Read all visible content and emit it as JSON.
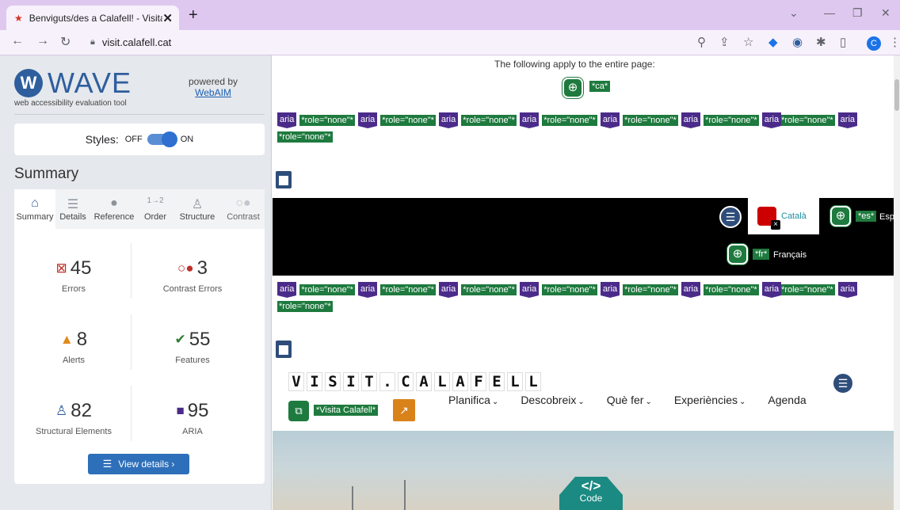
{
  "browser": {
    "tab_title": "Benviguts/des a Calafell! - Visita C",
    "url": "visit.calafell.cat",
    "profile_initial": "C"
  },
  "wave": {
    "logo_word": "WAVE",
    "tagline": "web accessibility evaluation tool",
    "powered_by": "powered by",
    "webaim_link": "WebAIM",
    "styles_label": "Styles:",
    "styles_off": "OFF",
    "styles_on": "ON",
    "summary_title": "Summary",
    "tabs": [
      {
        "label": "Summary",
        "icon": "home-icon"
      },
      {
        "label": "Details",
        "icon": "list-icon"
      },
      {
        "label": "Reference",
        "icon": "info-icon"
      },
      {
        "label": "Order",
        "icon": "order-icon"
      },
      {
        "label": "Structure",
        "icon": "structure-icon"
      },
      {
        "label": "Contrast",
        "icon": "contrast-icon"
      }
    ],
    "stats": {
      "errors": {
        "value": "45",
        "label": "Errors"
      },
      "contrast_errors": {
        "value": "3",
        "label": "Contrast Errors"
      },
      "alerts": {
        "value": "8",
        "label": "Alerts"
      },
      "features": {
        "value": "55",
        "label": "Features"
      },
      "structural": {
        "value": "82",
        "label": "Structural Elements"
      },
      "aria": {
        "value": "95",
        "label": "ARIA"
      }
    },
    "view_details": "View details ›"
  },
  "page": {
    "apply_text": "The following apply to the entire page:",
    "lang_tag": "*ca*",
    "aria_label": "aria",
    "role_none": "*role=\"none\"*",
    "catala": "Català",
    "es_tag": "*es*",
    "es_text": "Esp",
    "fr_tag": "*fr*",
    "fr_text": "Français",
    "logo": "VISIT.CALAFELL",
    "visita_tag": "*Visita Calafell*",
    "menu": [
      "Planifica",
      "Descobreix",
      "Què fer",
      "Experiències",
      "Agenda"
    ],
    "code_tag": "</>",
    "code_label": "Code"
  }
}
